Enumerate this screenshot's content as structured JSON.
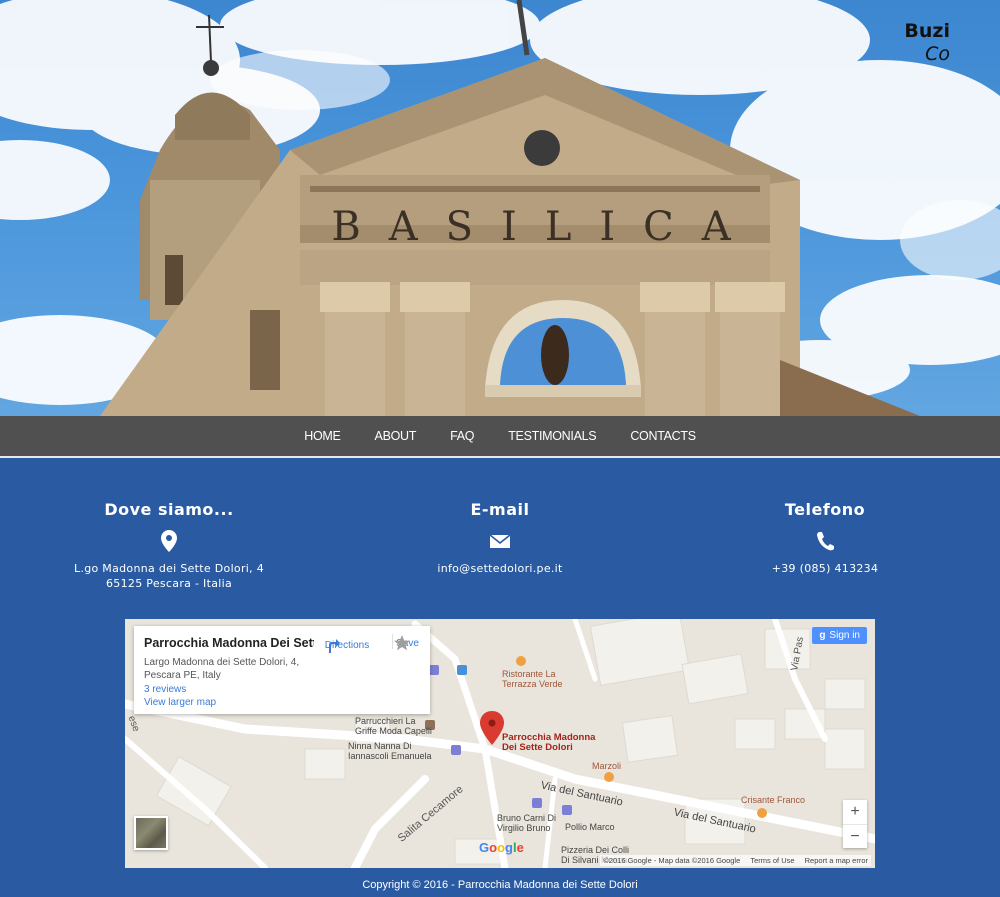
{
  "brand": {
    "line1": "Buzi",
    "line2": "Co"
  },
  "hero": {
    "facade_text": "BASILICA"
  },
  "nav": {
    "items": [
      "HOME",
      "ABOUT",
      "FAQ",
      "TESTIMONIALS",
      "CONTACTS"
    ]
  },
  "contacts": {
    "location": {
      "title": "Dove siamo...",
      "icon": "map-pin-icon",
      "line1": "L.go Madonna dei Sette Dolori, 4",
      "line2": "65125 Pescara - Italia"
    },
    "email": {
      "title": "E-mail",
      "icon": "envelope-icon",
      "value": "info@settedolori.pe.it"
    },
    "phone": {
      "title": "Telefono",
      "icon": "phone-icon",
      "value": "+39 (085) 413234"
    }
  },
  "map": {
    "card_title": "Parrocchia Madonna Dei Sett...",
    "card_address_1": "Largo Madonna dei Sette Dolori, 4,",
    "card_address_2": "Pescara PE, Italy",
    "reviews": "3 reviews",
    "larger_map": "View larger map",
    "directions": "Directions",
    "save": "Save",
    "sign_in": "Sign in",
    "marker_label_1": "Parrocchia Madonna",
    "marker_label_2": "Dei Sette Dolori",
    "labels": {
      "ristorante_1": "Ristorante La",
      "ristorante_2": "Terrazza Verde",
      "parrucchieri_1": "Parrucchieri La",
      "parrucchieri_2": "Griffe Moda Capelli",
      "ninna_1": "Ninna Nanna Di",
      "ninna_2": "Iannascoli Emanuela",
      "marzoli": "Marzoli",
      "crisante": "Crisante Franco",
      "via_santuario_1": "Via del Santuario",
      "via_santuario_2": "Via del Santuario",
      "salita": "Salita Cecamore",
      "bruno_1": "Bruno Carni Di",
      "bruno_2": "Virgilio Bruno",
      "pollio": "Pollio Marco",
      "pizzeria_1": "Pizzeria Dei Colli",
      "pizzeria_2": "Di Silvani Mosca",
      "via_pas": "Via Pas",
      "ese": "ese"
    },
    "zoom_in": "+",
    "zoom_out": "−",
    "google": [
      "G",
      "o",
      "o",
      "g",
      "l",
      "e"
    ],
    "google_colors": [
      "#4285f4",
      "#ea4335",
      "#fbbc05",
      "#4285f4",
      "#34a853",
      "#ea4335"
    ],
    "attribution": "©2016 Google - Map data ©2016 Google",
    "terms": "Terms of Use",
    "report": "Report a map error"
  },
  "footer": {
    "copyright": "Copyright © 2016 - Parrocchia Madonna dei Sette Dolori"
  },
  "colors": {
    "page_bg": "#2a5ba2",
    "nav_bg": "#505050",
    "pin_red": "#d93b30"
  }
}
